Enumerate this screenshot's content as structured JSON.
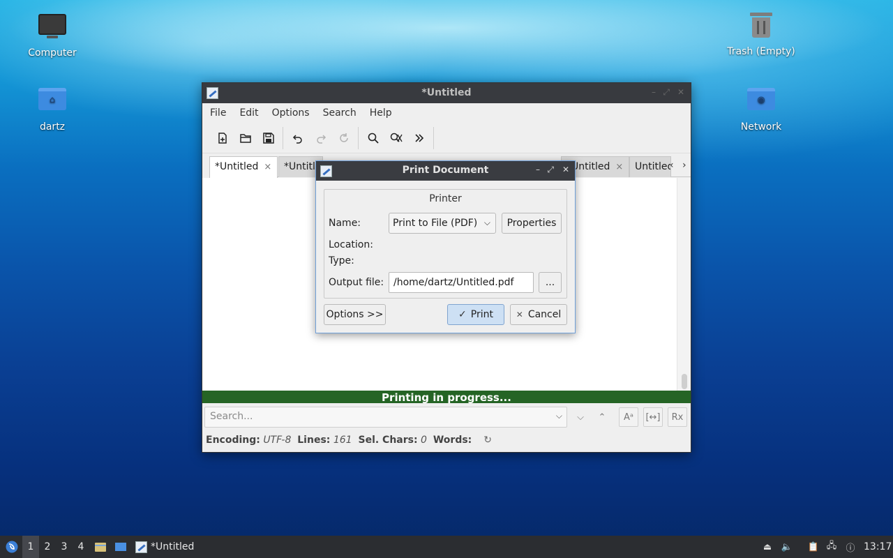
{
  "desktop": {
    "icons": [
      {
        "label": "Computer",
        "icon": "computer-icon"
      },
      {
        "label": "dartz",
        "icon": "home-folder-icon"
      },
      {
        "label": "Trash (Empty)",
        "icon": "trash-icon"
      },
      {
        "label": "Network",
        "icon": "network-folder-icon"
      }
    ]
  },
  "window": {
    "title": "*Untitled",
    "menu": [
      "File",
      "Edit",
      "Options",
      "Search",
      "Help"
    ],
    "toolbar": [
      {
        "name": "new-document-icon",
        "glyph": "🗋"
      },
      {
        "name": "open-folder-icon",
        "glyph": "📂"
      },
      {
        "name": "save-icon",
        "glyph": "💾"
      },
      {
        "name": "undo-icon",
        "glyph": "↶"
      },
      {
        "name": "redo-icon",
        "glyph": "↷"
      },
      {
        "name": "reload-icon",
        "glyph": "↻"
      },
      {
        "name": "find-icon",
        "glyph": "⚲"
      },
      {
        "name": "find-replace-icon",
        "glyph": "✂"
      },
      {
        "name": "more-icon",
        "glyph": "»"
      }
    ],
    "tabs": [
      {
        "label": "*Untitled",
        "close": "×"
      },
      {
        "label": "*Untitled",
        "close": "×"
      },
      {
        "label": "*Untitled",
        "close": "×"
      },
      {
        "label": "Untitled",
        "close": ""
      }
    ],
    "progress_text": "Printing in progress...",
    "search": {
      "placeholder": "Search..."
    },
    "status": {
      "encoding_label": "Encoding:",
      "encoding_value": "UTF-8",
      "lines_label": "Lines:",
      "lines_value": "161",
      "selchars_label": "Sel. Chars:",
      "selchars_value": "0",
      "words_label": "Words:"
    }
  },
  "dialog": {
    "title": "Print Document",
    "group_title": "Printer",
    "name_label": "Name:",
    "printer_selected": "Print to File (PDF)",
    "properties_button": "Properties",
    "location_label": "Location:",
    "type_label": "Type:",
    "output_label": "Output file:",
    "output_value": "/home/dartz/Untitled.pdf",
    "browse_button": "...",
    "options_button": "Options >>",
    "print_button": "Print",
    "cancel_button": "Cancel"
  },
  "taskbar": {
    "workspaces": [
      "1",
      "2",
      "3",
      "4"
    ],
    "active_workspace": "1",
    "task_label": "*Untitled",
    "clock": "13:17"
  },
  "colors": {
    "progress": "#256425",
    "dialog_border": "#6f9fd8",
    "primary_button": "#cde0f4"
  }
}
